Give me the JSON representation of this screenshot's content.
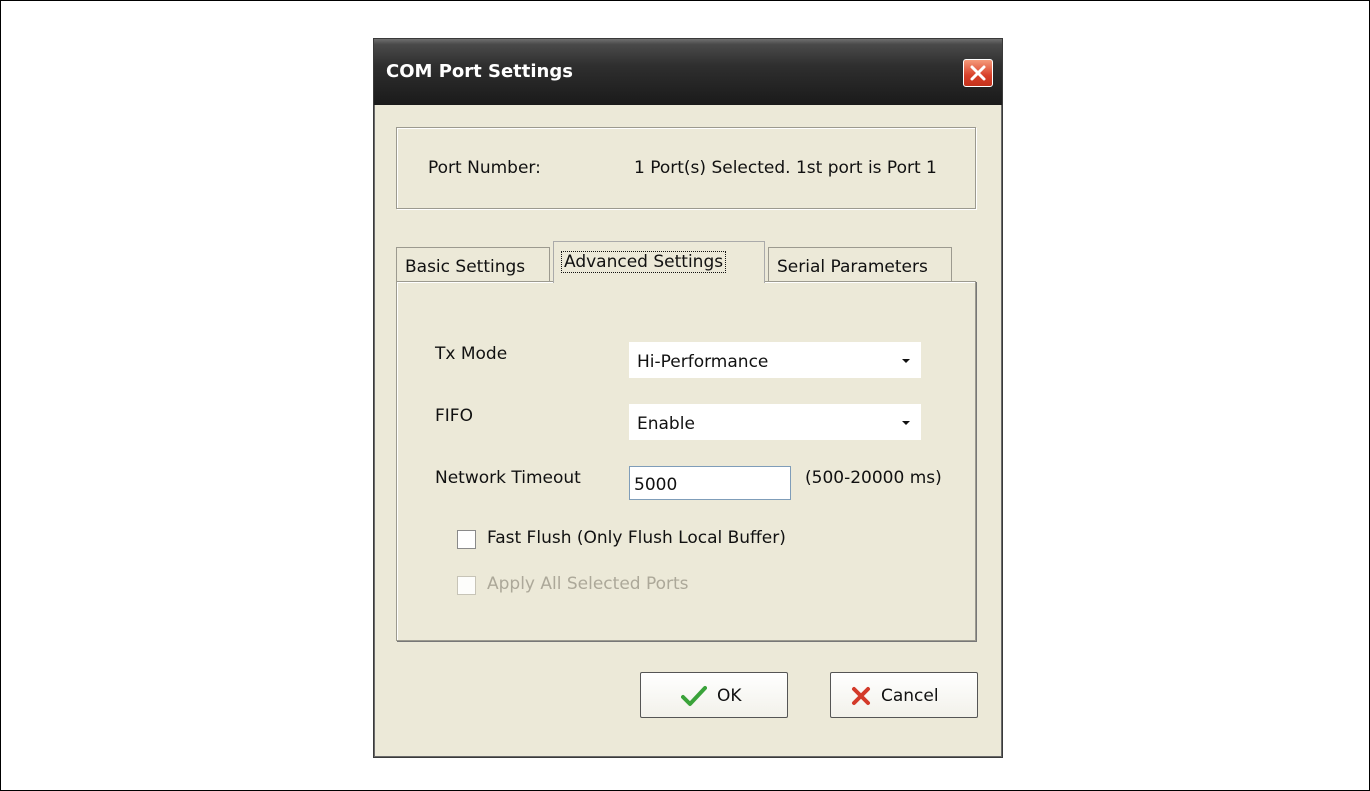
{
  "dialog": {
    "title": "COM Port Settings",
    "port_label": "Port Number:",
    "port_value": "1 Port(s) Selected. 1st port is Port 1"
  },
  "tabs": [
    {
      "label": "Basic Settings",
      "active": false
    },
    {
      "label": "Advanced Settings",
      "active": true
    },
    {
      "label": "Serial Parameters",
      "active": false
    }
  ],
  "advanced": {
    "tx_mode_label": "Tx Mode",
    "tx_mode_value": "Hi-Performance",
    "fifo_label": "FIFO",
    "fifo_value": "Enable",
    "timeout_label": "Network Timeout",
    "timeout_value": "5000",
    "timeout_range": "(500-20000 ms)",
    "fast_flush_label": "Fast Flush (Only Flush Local Buffer)",
    "fast_flush_checked": false,
    "apply_all_label": "Apply All Selected Ports",
    "apply_all_checked": false
  },
  "buttons": {
    "ok": "OK",
    "cancel": "Cancel"
  },
  "colors": {
    "dialog_bg": "#ece9d8",
    "titlebar": "#1a1a1a",
    "close_button": "#d8402a",
    "ok_check": "#3aa33a",
    "cancel_x": "#d33a2a"
  }
}
